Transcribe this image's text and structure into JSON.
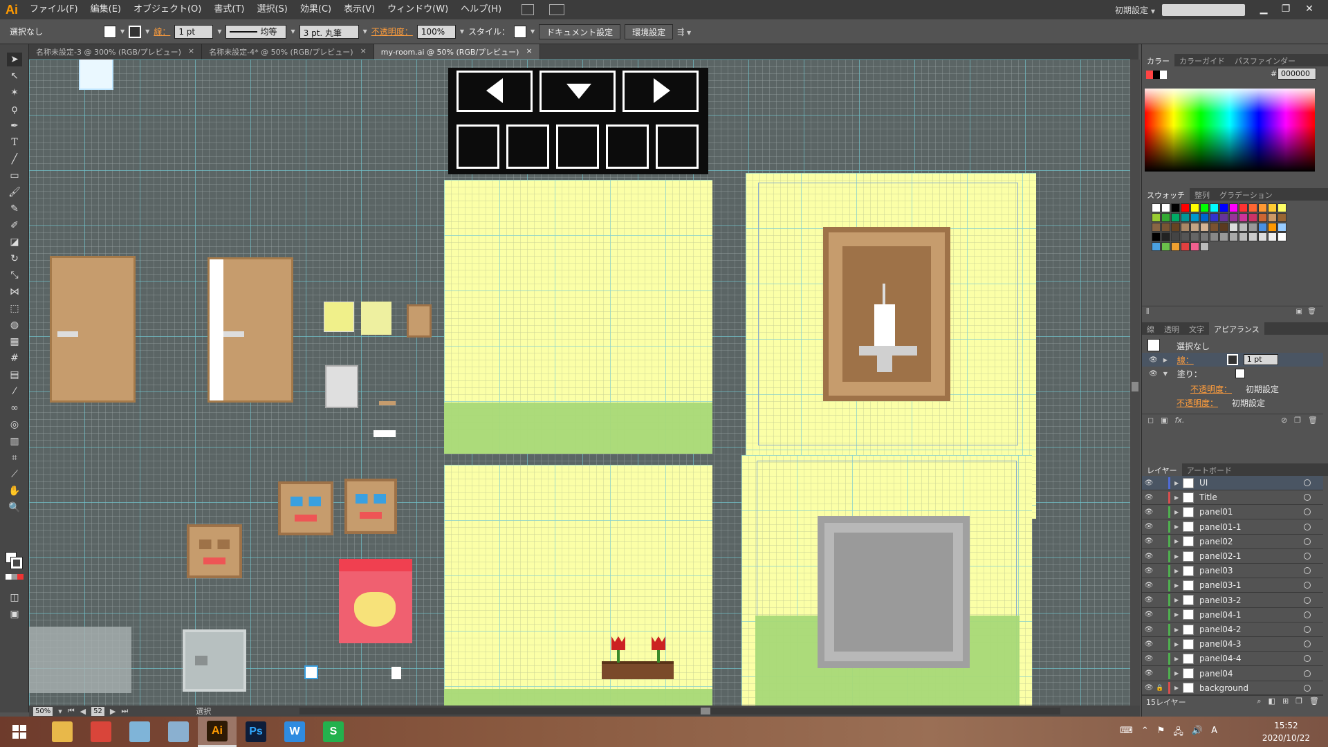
{
  "app": {
    "logo": "Ai"
  },
  "menu": [
    "ファイル(F)",
    "編集(E)",
    "オブジェクト(O)",
    "書式(T)",
    "選択(S)",
    "効果(C)",
    "表示(V)",
    "ウィンドウ(W)",
    "ヘルプ(H)"
  ],
  "workspace": "初期設定",
  "control": {
    "selection": "選択なし",
    "stroke_label": "線：",
    "stroke_weight": "1 pt",
    "stroke_profile": "均等",
    "brush": "3 pt. 丸筆",
    "opacity_label": "不透明度：",
    "opacity": "100%",
    "style_label": "スタイル：",
    "doc_settings": "ドキュメント設定",
    "prefs": "環境設定"
  },
  "tabs": [
    {
      "label": "名称未設定-3 @ 300% (RGB/プレビュー)",
      "close": "×"
    },
    {
      "label": "名称未設定-4* @ 50% (RGB/プレビュー)",
      "close": "×"
    },
    {
      "label": "my-room.ai @ 50% (RGB/プレビュー)",
      "close": "×"
    }
  ],
  "status": {
    "zoom": "50%",
    "page": "52",
    "tool": "選択"
  },
  "color_panel": {
    "tabs": [
      "カラー",
      "カラーガイド",
      "パスファインダー"
    ],
    "hex_label": "#",
    "hex": "000000"
  },
  "swatch_panel": {
    "tabs": [
      "スウォッチ",
      "整列",
      "グラデーション"
    ]
  },
  "appearance_panel": {
    "tabs": [
      "線",
      "透明",
      "文字",
      "アピアランス"
    ],
    "title": "選択なし",
    "stroke_label": "線：",
    "stroke_weight": "1 pt",
    "fill_label": "塗り：",
    "opacity1_label": "不透明度：",
    "opacity1_value": "初期設定",
    "opacity2_label": "不透明度：",
    "opacity2_value": "初期設定"
  },
  "layers_panel": {
    "tabs": [
      "レイヤー",
      "アートボード"
    ],
    "layers": [
      {
        "name": "UI",
        "color": "#4f6bd8"
      },
      {
        "name": "Title",
        "color": "#d84f4f"
      },
      {
        "name": "panel01",
        "color": "#4fb04f"
      },
      {
        "name": "panel01-1",
        "color": "#4fb04f"
      },
      {
        "name": "panel02",
        "color": "#4fb04f"
      },
      {
        "name": "panel02-1",
        "color": "#4fb04f"
      },
      {
        "name": "panel03",
        "color": "#4fb04f"
      },
      {
        "name": "panel03-1",
        "color": "#4fb04f"
      },
      {
        "name": "panel03-2",
        "color": "#4fb04f"
      },
      {
        "name": "panel04-1",
        "color": "#4fb04f"
      },
      {
        "name": "panel04-2",
        "color": "#4fb04f"
      },
      {
        "name": "panel04-3",
        "color": "#4fb04f"
      },
      {
        "name": "panel04-4",
        "color": "#4fb04f"
      },
      {
        "name": "panel04",
        "color": "#4fb04f"
      },
      {
        "name": "background",
        "color": "#d84f4f"
      }
    ],
    "count": "15レイヤー"
  },
  "taskbar": {
    "apps": [
      {
        "name": "explorer",
        "label": "",
        "color": "#e8b84a"
      },
      {
        "name": "chrome",
        "label": "",
        "color": "#d9453a"
      },
      {
        "name": "notepad",
        "label": "",
        "color": "#7fb4d8"
      },
      {
        "name": "calculator",
        "label": "",
        "color": "#8ab0d0"
      },
      {
        "name": "illustrator",
        "label": "Ai",
        "color": "#2d1a05"
      },
      {
        "name": "photoshop",
        "label": "Ps",
        "color": "#0d1d3a"
      },
      {
        "name": "writer",
        "label": "W",
        "color": "#2f8be0"
      },
      {
        "name": "spreadsheet",
        "label": "S",
        "color": "#23b14d"
      }
    ],
    "time": "15:52",
    "date": "2020/10/22",
    "ime": "A"
  }
}
